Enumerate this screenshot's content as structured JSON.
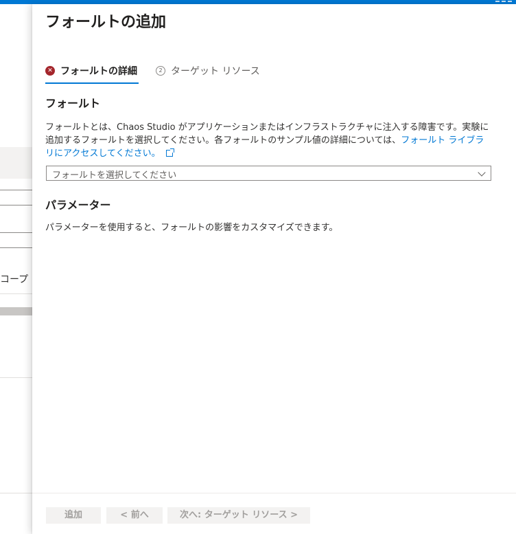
{
  "background_page": {
    "scope_label_fragment": "コープ"
  },
  "panel": {
    "title": "フォールトの追加",
    "tabs": [
      {
        "label": "フォールトの詳細",
        "state": "error",
        "icon": "error-icon"
      },
      {
        "label": "ターゲット リソース",
        "number": "2",
        "icon": "step-number-icon"
      }
    ],
    "fault_section": {
      "heading": "フォールト",
      "description_prefix": "フォールトとは、Chaos Studio がアプリケーションまたはインフラストラクチャに注入する障害です。実験に追加するフォールトを選択してください。各フォールトのサンプル値の詳細については、",
      "link_text": "フォールト ライブラリにアクセスしてください。",
      "link_icon": "external-link-icon",
      "dropdown_placeholder": "フォールトを選択してください"
    },
    "parameters_section": {
      "heading": "パラメーター",
      "description": "パラメーターを使用すると、フォールトの影響をカスタマイズできます。"
    },
    "footer": {
      "add_label": "追加",
      "prev_label": "< 前へ",
      "next_label": "次へ: ターゲット リソース >"
    }
  },
  "colors": {
    "accent": "#0078d4",
    "error": "#a4262c",
    "disabled_bg": "#f3f2f1",
    "disabled_text": "#a19f9d"
  }
}
